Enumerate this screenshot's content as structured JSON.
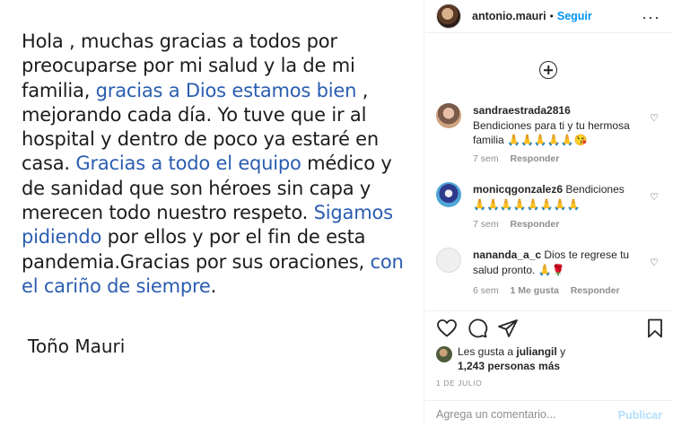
{
  "post": {
    "text_segments": [
      {
        "text": "Hola , muchas gracias a todos por preocuparse por mi salud y la de mi familia, ",
        "highlight": false
      },
      {
        "text": "gracias a Dios estamos bien",
        "highlight": true
      },
      {
        "text": " , mejorando cada día. Yo tuve que ir al hospital y dentro de poco ya estaré en casa. ",
        "highlight": false
      },
      {
        "text": "Gracias a todo el equipo",
        "highlight": true
      },
      {
        "text": " médico y de sanidad que son héroes sin capa y merecen todo nuestro respeto. ",
        "highlight": false
      },
      {
        "text": "Sigamos pidiendo",
        "highlight": true
      },
      {
        "text": " por ellos  y por el fin de esta pandemia.Gracias por sus oraciones, ",
        "highlight": false
      },
      {
        "text": "con el cariño de siempre",
        "highlight": true
      },
      {
        "text": ".",
        "highlight": false
      }
    ],
    "signature": "Toño Mauri",
    "highlight_color": "#2a5db0"
  },
  "header": {
    "username": "antonio.mauri",
    "separator": "•",
    "follow_label": "Seguir",
    "more_label": "···"
  },
  "comments": [
    {
      "username": "sandraestrada2816",
      "text": "Bendiciones para ti y tu hermosa familia",
      "emojis": "🙏🙏🙏🙏🙏😘",
      "time": "7 sem",
      "likes": "",
      "reply_label": "Responder"
    },
    {
      "username": "monicqgonzalez6",
      "text": "Bendiciones",
      "emojis": "🙏🙏🙏🙏🙏🙏🙏🙏",
      "time": "7 sem",
      "likes": "",
      "reply_label": "Responder"
    },
    {
      "username": "nananda_a_c",
      "text": "Dios te regrese tu salud pronto.",
      "emojis": "🙏🌹",
      "time": "6 sem",
      "likes": "1 Me gusta",
      "reply_label": "Responder"
    }
  ],
  "likes": {
    "prefix": "Les gusta a ",
    "user": "juliangil",
    "conjunction": " y",
    "count": "1,243 personas más"
  },
  "date": "1 DE JULIO",
  "comment_box": {
    "placeholder": "Agrega un comentario...",
    "publish_label": "Publicar"
  },
  "colors": {
    "accent": "#0095f6",
    "publish_disabled": "#b2dffc",
    "muted": "#8e8e8e"
  },
  "icons": [
    "heart-icon",
    "comment-icon",
    "share-icon",
    "bookmark-icon",
    "add-circle-icon",
    "more-icon"
  ]
}
